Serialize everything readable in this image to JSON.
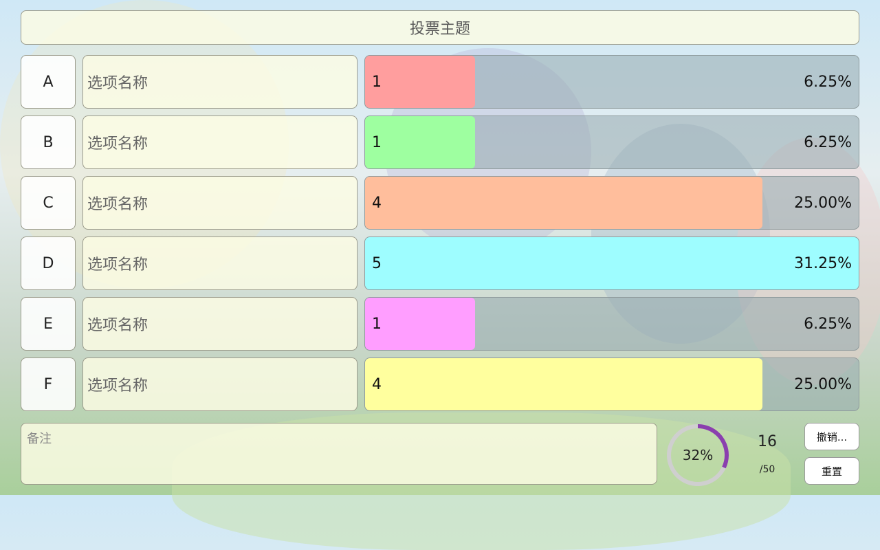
{
  "title": "投票主题",
  "note_placeholder": "备注",
  "options": [
    {
      "letter": "A",
      "name": "选项名称",
      "count": "1",
      "percent": "6.25%",
      "fraction": 0.2222,
      "color": "#ff9e9e"
    },
    {
      "letter": "B",
      "name": "选项名称",
      "count": "1",
      "percent": "6.25%",
      "fraction": 0.2222,
      "color": "#9effa0"
    },
    {
      "letter": "C",
      "name": "选项名称",
      "count": "4",
      "percent": "25.00%",
      "fraction": 0.8056,
      "color": "#ffbe9c"
    },
    {
      "letter": "D",
      "name": "选项名称",
      "count": "5",
      "percent": "31.25%",
      "fraction": 1.0,
      "color": "#9efdff"
    },
    {
      "letter": "E",
      "name": "选项名称",
      "count": "1",
      "percent": "6.25%",
      "fraction": 0.2222,
      "color": "#ff9eff"
    },
    {
      "letter": "F",
      "name": "选项名称",
      "count": "4",
      "percent": "25.00%",
      "fraction": 0.8056,
      "color": "#ffff9e"
    }
  ],
  "progress": {
    "label": "32%",
    "value": 0.32,
    "color": "#8a3fae",
    "track": "#cfcfcf"
  },
  "votes": {
    "count": "16",
    "total": "/50"
  },
  "buttons": {
    "undo": "撤销...",
    "reset": "重置"
  }
}
